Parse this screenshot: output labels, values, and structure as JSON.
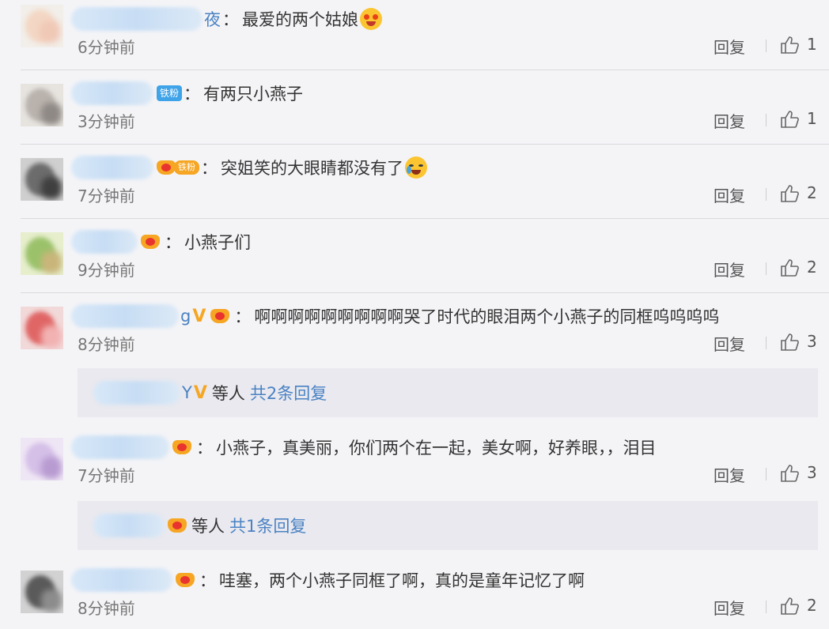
{
  "comments": [
    {
      "name_tail": "夜",
      "badge": "",
      "text": "最爱的两个姑娘",
      "emoji": "heart-eyes",
      "time": "6分钟前",
      "reply": "回复",
      "likes": "1"
    },
    {
      "name_tail": "",
      "badge": "fan",
      "badge_text": "铁粉",
      "text": "有两只小燕子",
      "emoji": "",
      "time": "3分钟前",
      "reply": "回复",
      "likes": "1"
    },
    {
      "name_tail": "",
      "badge": "crown-pill",
      "badge_text": "",
      "text": "突姐笑的大眼睛都没有了",
      "emoji": "laugh-cry",
      "time": "7分钟前",
      "reply": "回复",
      "likes": "2"
    },
    {
      "name_tail": "",
      "badge": "crown",
      "text": "小燕子们",
      "emoji": "",
      "time": "9分钟前",
      "reply": "回复",
      "likes": "2"
    },
    {
      "name_tail": "g",
      "badge": "v-crown",
      "text": "啊啊啊啊啊啊啊啊啊哭了时代的眼泪两个小燕子的同框呜呜呜呜",
      "emoji": "",
      "time": "8分钟前",
      "reply": "回复",
      "likes": "3",
      "replies": {
        "name_tail": "Y",
        "badge": "v",
        "suffix": "等人",
        "link": "共2条回复"
      }
    },
    {
      "name_tail": "",
      "badge": "crown",
      "text": "小燕子，真美丽，你们两个在一起，美女啊，好养眼，，泪目",
      "emoji": "",
      "time": "7分钟前",
      "reply": "回复",
      "likes": "3",
      "replies": {
        "name_tail": "",
        "badge": "crown",
        "suffix": "等人",
        "link": "共1条回复"
      }
    },
    {
      "name_tail": "",
      "badge": "crown",
      "text": "哇塞，两个小燕子同框了啊，真的是童年记忆了啊",
      "emoji": "",
      "time": "8分钟前",
      "reply": "回复",
      "likes": "2"
    }
  ]
}
